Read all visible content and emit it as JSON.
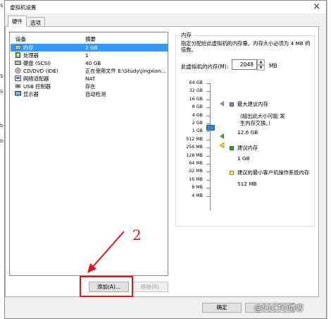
{
  "window": {
    "title": "虚拟机设置",
    "close_glyph": "×"
  },
  "tabs": [
    {
      "label": "硬件",
      "active": true
    },
    {
      "label": "选项",
      "active": false
    }
  ],
  "device_list": {
    "col_device": "设备",
    "col_summary": "摘要",
    "rows": [
      {
        "name": "内存",
        "summary": "2 GB",
        "icon": "memory-icon",
        "selected": true
      },
      {
        "name": "处理器",
        "summary": "1",
        "icon": "processor-icon"
      },
      {
        "name": "硬盘 (SCSI)",
        "summary": "40 GB",
        "icon": "hard-disk-icon"
      },
      {
        "name": "CD/DVD (IDE)",
        "summary": "正在使用文件 E:\\Study\\jingxian...",
        "icon": "cd-dvd-icon"
      },
      {
        "name": "网络适配器",
        "summary": "NAT",
        "icon": "network-adapter-icon"
      },
      {
        "name": "USB 控制器",
        "summary": "存在",
        "icon": "usb-controller-icon"
      },
      {
        "name": "显示器",
        "summary": "自动检测",
        "icon": "display-icon"
      }
    ]
  },
  "buttons": {
    "add": "添加(A)...",
    "remove": "移除(R)",
    "ok": "确定",
    "cancel": ""
  },
  "annotation": {
    "number": "2",
    "color": "#e0141b"
  },
  "memory": {
    "group_title": "内存",
    "description": "指定分配给此虚拟机的内存量。内存大小必须为 4 MB 的倍数。",
    "field_label": "此虚拟机的内存(M):",
    "value": "2048",
    "unit": "MB",
    "scale": [
      "64 GB",
      "32 GB",
      "16 GB",
      "8 GB",
      "4 GB",
      "2 GB",
      "1 GB",
      "512 MB",
      "256 MB",
      "128 MB",
      "64 MB",
      "32 MB",
      "16 MB",
      "8 MB",
      "4 MB"
    ],
    "legend": {
      "max_recommended": {
        "label": "最大建议内存",
        "note": "(超出此大小可能 发生内存交换。)",
        "value": "12.6 GB",
        "color": "#7a8ea8"
      },
      "recommended": {
        "label": "建议内存",
        "value": "1 GB",
        "color": "#2fa52f"
      },
      "guest_min": {
        "label": "建议的最小客户机操作系统内存",
        "value": "512 MB",
        "color": "#e8d840"
      }
    }
  },
  "background": {
    "left_fragments": [
      "$",
      "a",
      "S-",
      "S-",
      "b-",
      "b-",
      "S-",
      "a",
      "a",
      "a",
      "a",
      "a",
      "a",
      "a",
      "a",
      "a",
      "a",
      "a",
      "a",
      "a",
      "a",
      "a",
      "a",
      "a",
      "a"
    ]
  },
  "watermark": "@51CTO博客",
  "colors": {
    "accent": "#3399ff",
    "slider": "#3c7fd0"
  }
}
